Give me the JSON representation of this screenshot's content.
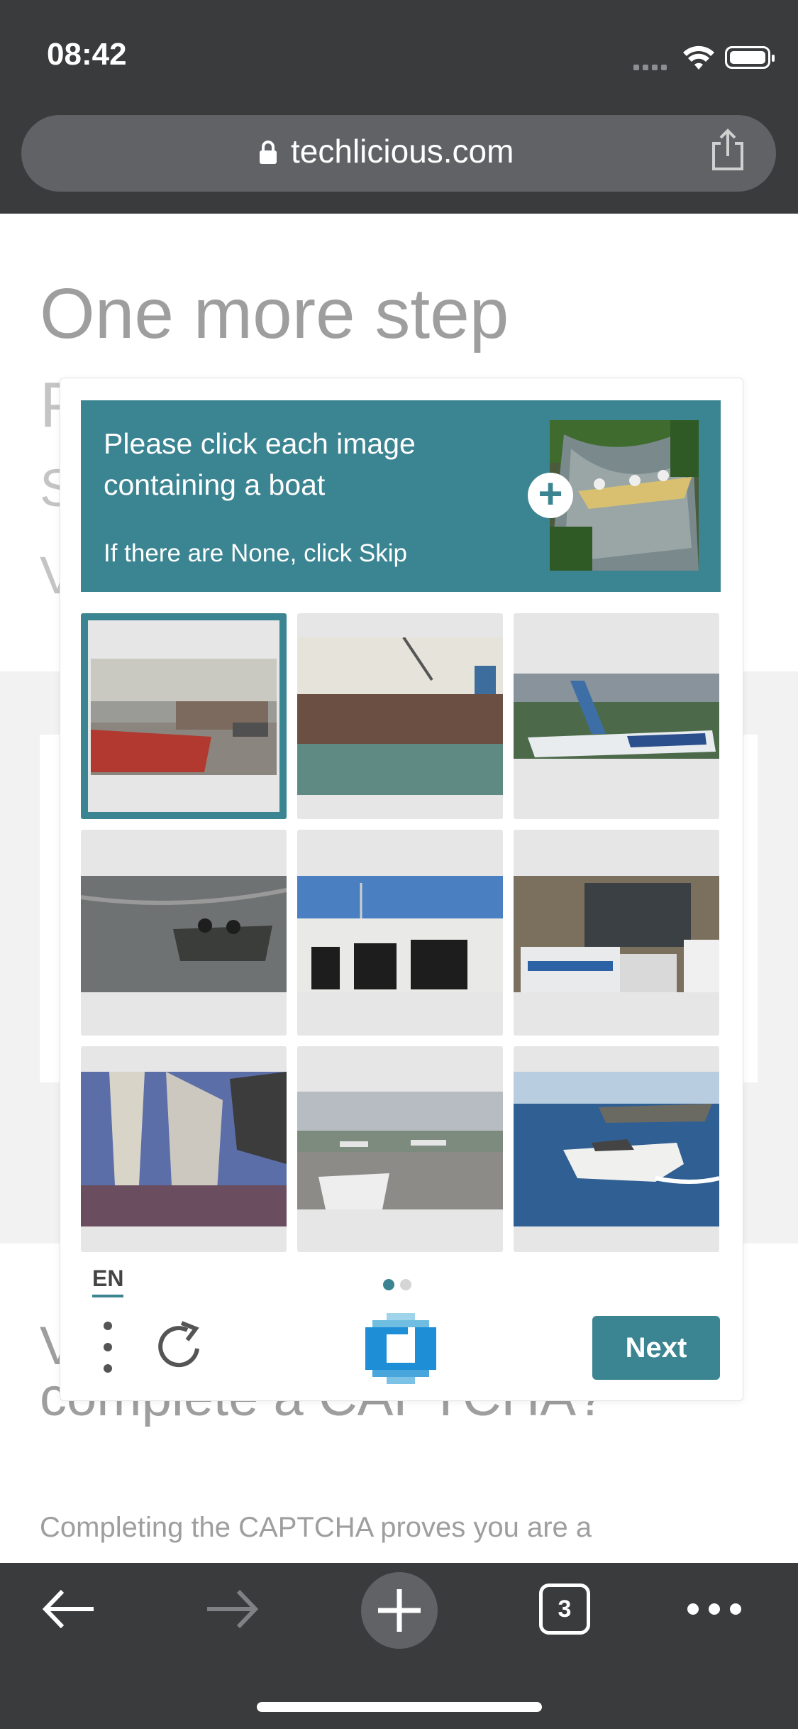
{
  "status_bar": {
    "time": "08:42"
  },
  "browser": {
    "url": "techlicious.com",
    "tab_count": "3"
  },
  "page": {
    "heading": "One more step",
    "ghost_lines": [
      "P",
      "S",
      "V"
    ],
    "section_heading_partial": "V",
    "section_heading_line2": "complete a CAPTCHA?",
    "paragraph": "Completing the CAPTCHA proves you are a"
  },
  "captcha": {
    "prompt": "Please click each image containing a boat",
    "subprompt": "If there are None, click Skip",
    "language": "EN",
    "next_label": "Next",
    "page_indicator": {
      "current": 1,
      "total": 2
    },
    "tiles": [
      {
        "label": "harbor-boat-street",
        "selected": true
      },
      {
        "label": "rusty-ship-hull",
        "selected": false
      },
      {
        "label": "airplane-landing",
        "selected": false
      },
      {
        "label": "raft-on-water",
        "selected": false
      },
      {
        "label": "white-bus",
        "selected": false
      },
      {
        "label": "traffic-bus-cars",
        "selected": false
      },
      {
        "label": "sailboats",
        "selected": false
      },
      {
        "label": "airport-runway",
        "selected": false
      },
      {
        "label": "speedboat",
        "selected": false
      }
    ],
    "colors": {
      "accent": "#3b8491",
      "tile_bg": "#e6e6e6"
    }
  }
}
